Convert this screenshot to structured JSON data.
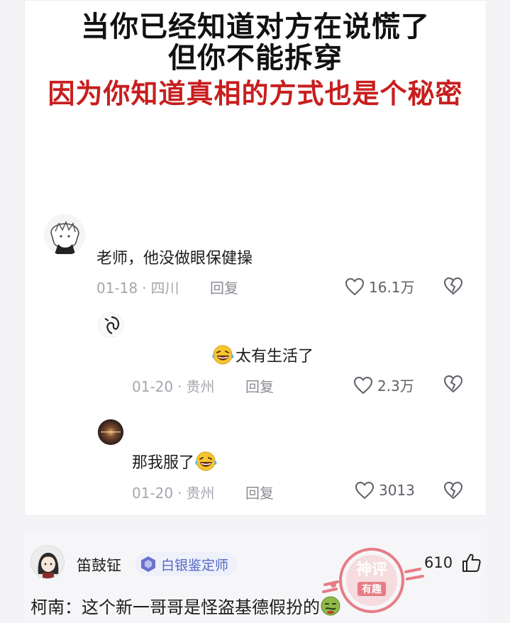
{
  "meme": {
    "headline_line1": "当你已经知道对方在说慌了",
    "headline_line2": "但你不能拆穿",
    "headline_line3": "因为你知道真相的方式也是个秘密",
    "colors": {
      "headline_black": "#111111",
      "headline_red": "#c81e1e"
    },
    "comments": [
      {
        "text": "老师，他没做眼保健操",
        "date": "01-18",
        "location": "四川",
        "reply": "回复",
        "likes": "16.1万",
        "avatar": "anime-avatar-icon"
      },
      {
        "text": "太有生活了",
        "date": "01-20",
        "location": "贵州",
        "reply": "回复",
        "likes": "2.3万",
        "emoji": "laughing-crying-emoji-icon",
        "avatar": "sketch-avatar-icon"
      },
      {
        "text": "那我服了",
        "date": "01-20",
        "location": "贵州",
        "reply": "回复",
        "likes": "3013",
        "emoji": "laughing-crying-emoji-icon",
        "avatar": "dark-avatar-icon"
      }
    ],
    "meta_separator": "·"
  },
  "comment_bar": {
    "user_name": "笛鼓钲",
    "badge_text": "白银鉴定师",
    "score": "610",
    "body_text": "柯南：这个新一哥哥是怪盗基德假扮的",
    "watermark": {
      "top": "神评",
      "bottom": "有趣"
    },
    "colors": {
      "badge_bg": "#eef0fa",
      "badge_text": "#5468c4",
      "watermark": "#e35a66"
    }
  }
}
